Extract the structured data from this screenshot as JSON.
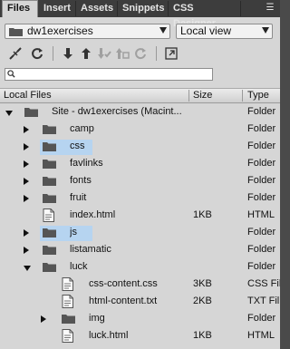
{
  "tabs": [
    {
      "label": "Files",
      "active": true
    },
    {
      "label": "Insert",
      "active": false
    },
    {
      "label": "Assets",
      "active": false
    },
    {
      "label": "Snippets",
      "active": false
    },
    {
      "label": "CSS Designer",
      "active": false
    }
  ],
  "site_select": {
    "value": "dw1exercises"
  },
  "view_select": {
    "value": "Local view"
  },
  "toolbar": {
    "icons": [
      "disconnect-icon",
      "refresh-icon",
      "get-files-icon",
      "put-files-icon",
      "check-out-icon",
      "check-in-icon",
      "sync-icon",
      "expand-icon"
    ]
  },
  "search": {
    "placeholder": ""
  },
  "columns": {
    "name": "Local Files",
    "size": "Size",
    "type": "Type"
  },
  "rows": [
    {
      "name": "Site - dw1exercises (Macint...",
      "size": "",
      "type": "Folder",
      "kind": "site",
      "indent": 0,
      "arrow": "down",
      "selected": false
    },
    {
      "name": "camp",
      "size": "",
      "type": "Folder",
      "kind": "folder",
      "indent": 1,
      "arrow": "right",
      "selected": false
    },
    {
      "name": "css",
      "size": "",
      "type": "Folder",
      "kind": "folder",
      "indent": 1,
      "arrow": "right",
      "selected": true
    },
    {
      "name": "favlinks",
      "size": "",
      "type": "Folder",
      "kind": "folder",
      "indent": 1,
      "arrow": "right",
      "selected": false
    },
    {
      "name": "fonts",
      "size": "",
      "type": "Folder",
      "kind": "folder",
      "indent": 1,
      "arrow": "right",
      "selected": false
    },
    {
      "name": "fruit",
      "size": "",
      "type": "Folder",
      "kind": "folder",
      "indent": 1,
      "arrow": "right",
      "selected": false
    },
    {
      "name": "index.html",
      "size": "1KB",
      "type": "HTML",
      "kind": "file",
      "indent": 1,
      "arrow": "none",
      "selected": false
    },
    {
      "name": "js",
      "size": "",
      "type": "Folder",
      "kind": "folder",
      "indent": 1,
      "arrow": "right",
      "selected": true
    },
    {
      "name": "listamatic",
      "size": "",
      "type": "Folder",
      "kind": "folder",
      "indent": 1,
      "arrow": "right",
      "selected": false
    },
    {
      "name": "luck",
      "size": "",
      "type": "Folder",
      "kind": "folder",
      "indent": 1,
      "arrow": "down",
      "selected": false
    },
    {
      "name": "css-content.css",
      "size": "3KB",
      "type": "CSS Fil",
      "kind": "file",
      "indent": 2,
      "arrow": "none",
      "selected": false
    },
    {
      "name": "html-content.txt",
      "size": "2KB",
      "type": "TXT Fil",
      "kind": "file",
      "indent": 2,
      "arrow": "none",
      "selected": false
    },
    {
      "name": "img",
      "size": "",
      "type": "Folder",
      "kind": "folder",
      "indent": 2,
      "arrow": "right",
      "selected": false
    },
    {
      "name": "luck.html",
      "size": "1KB",
      "type": "HTML",
      "kind": "file",
      "indent": 2,
      "arrow": "none",
      "selected": false
    }
  ],
  "colors": {
    "selection": "#b6d4f0",
    "panel": "#d6d6d6",
    "tabbar": "#3d3d3d"
  }
}
